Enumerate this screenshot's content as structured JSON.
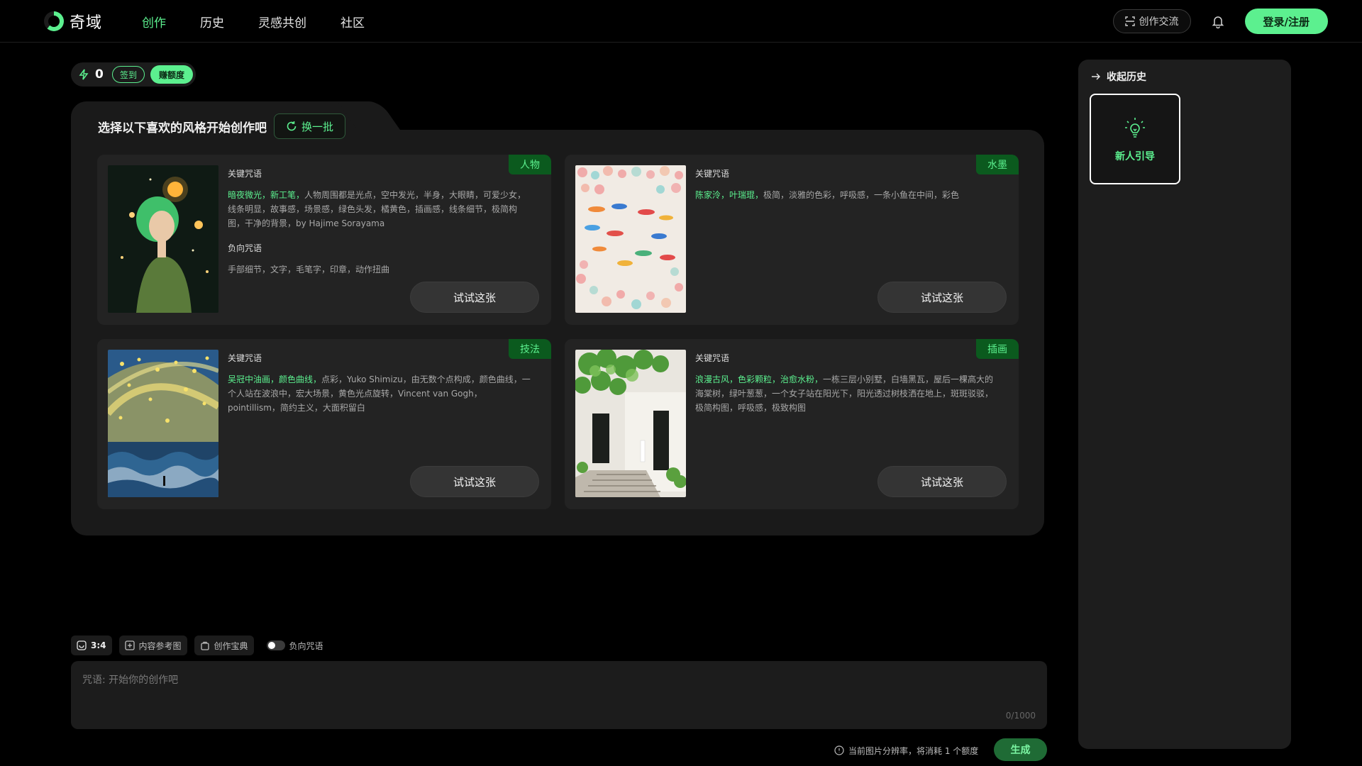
{
  "brand": {
    "name": "奇域"
  },
  "nav": {
    "items": [
      {
        "label": "创作",
        "active": true
      },
      {
        "label": "历史",
        "active": false
      },
      {
        "label": "灵感共创",
        "active": false
      },
      {
        "label": "社区",
        "active": false
      }
    ]
  },
  "header": {
    "chat_label": "创作交流",
    "login_label": "登录/注册"
  },
  "quota": {
    "count": "0",
    "checkin_label": "签到",
    "earn_label": "赚额度"
  },
  "styles": {
    "title": "选择以下喜欢的风格开始创作吧",
    "refresh_label": "换一批",
    "cards": [
      {
        "tag": "人物",
        "key_heading": "关键咒语",
        "highlight": "暗夜微光，新工笔，",
        "prompt": "人物周围都是光点，空中发光，半身，大眼睛，可爱少女，线条明显，故事感，场景感，绿色头发，橘黄色，插画感，线条细节，极简构图，干净的背景，by Hajime Sorayama",
        "neg_heading": "负向咒语",
        "negative": "手部细节，文字，毛笔字，印章，动作扭曲",
        "button": "试试这张"
      },
      {
        "tag": "水墨",
        "key_heading": "关键咒语",
        "highlight": "陈家泠，叶瑞琨，",
        "prompt": "极简，淡雅的色彩，呼吸感，一条小鱼在中间，彩色",
        "neg_heading": "",
        "negative": "",
        "button": "试试这张"
      },
      {
        "tag": "技法",
        "key_heading": "关键咒语",
        "highlight": "吴冠中油画，颜色曲线，",
        "prompt": "点彩，Yuko Shimizu，由无数个点构成，颜色曲线，一个人站在波浪中，宏大场景，黄色光点旋转，Vincent van Gogh，pointillism，简约主义，大面积留白",
        "neg_heading": "",
        "negative": "",
        "button": "试试这张"
      },
      {
        "tag": "插画",
        "key_heading": "关键咒语",
        "highlight": "浪漫古风，色彩颗粒，治愈水粉，",
        "prompt": "一栋三层小别墅，白墙黑瓦，屋后一棵高大的海棠树，绿叶葱葱，一个女子站在阳光下，阳光透过树枝洒在地上，斑斑驳驳，极简构图，呼吸感，极致构图",
        "neg_heading": "",
        "negative": "",
        "button": "试试这张"
      }
    ]
  },
  "toolbar": {
    "ratio": "3:4",
    "reference": "内容参考图",
    "handbook": "创作宝典",
    "negative_toggle": "负向咒语"
  },
  "prompt_box": {
    "placeholder": "咒语: 开始你的创作吧",
    "counter": "0/1000"
  },
  "footer": {
    "note": "当前图片分辨率，将消耗 1 个额度",
    "generate": "生成"
  },
  "history": {
    "collapse_label": "收起历史",
    "guide_label": "新人引导"
  },
  "colors": {
    "accent": "#5cf08f",
    "panel": "#1a1a1a",
    "card": "#232323",
    "tag_bg": "#0b5a1e"
  }
}
